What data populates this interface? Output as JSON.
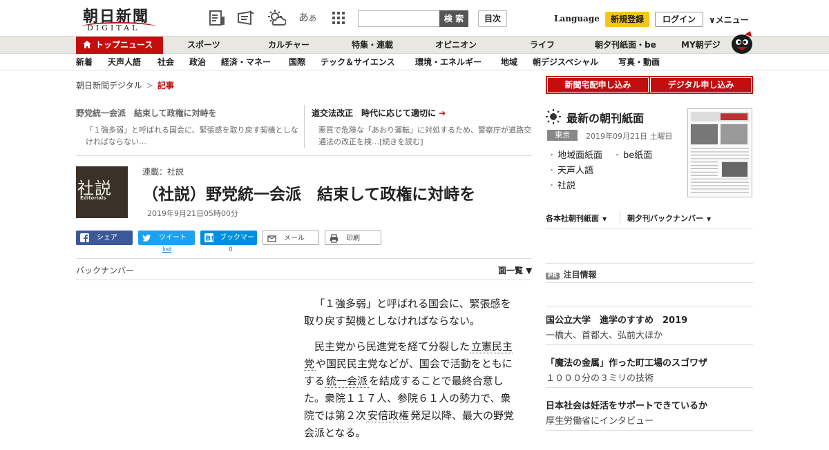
{
  "header": {
    "logo_jp": "朝日新聞",
    "logo_en": "DIGITAL",
    "icons": [
      "paper-view-icon",
      "newsletter-icon",
      "weather-icon"
    ],
    "font_size_label": "あ",
    "font_size_small": "あ",
    "search_placeholder": "",
    "search_button": "検 索",
    "contents_button": "目次",
    "language": "Language",
    "register": "新規登録",
    "login": "ログイン",
    "menu": "∨メニュー"
  },
  "nav_primary": [
    "トップニュース",
    "スポーツ",
    "カルチャー",
    "特集・連載",
    "オピニオン",
    "ライフ",
    "朝夕刊紙面・be",
    "MY朝デジ"
  ],
  "nav_secondary": [
    "新着",
    "天声人語",
    "社会",
    "政治",
    "経済・マネー",
    "国際",
    "テック＆サイエンス",
    "環境・エネルギー",
    "地域",
    "朝デジスペシャル",
    "写真・動画"
  ],
  "breadcrumb": {
    "root": "朝日新聞デジタル",
    "sep": ">",
    "current": "記事"
  },
  "related": [
    {
      "title": "野党統一会派　結束して政権に対峙を",
      "desc": "「１強多弱」と呼ばれる国会に、緊張感を取り戻す契機としなければならない…"
    },
    {
      "title": "道交法改正　時代に応じて適切に",
      "arrow": "➔",
      "desc": "悪質で危険な「あおり運転」に対処するため、警察庁が道路交通法の改正を検…[続きを読む]"
    }
  ],
  "article": {
    "image_kanji": "社説",
    "image_en": "Editorials",
    "series": "連載：社説",
    "headline": "（社説）野党統一会派　結束して政権に対峙を",
    "date": "2019年9月21日05時00分",
    "paragraph1": "「１強多弱」と呼ばれる国会に、緊張感を取り戻す契機としなければならない。",
    "p2_a": "民主党から民進党を経て分裂した",
    "p2_kw1": "立憲民主党",
    "p2_b": "や国民民主党などが、国会で活動をともにする",
    "p2_kw2": "統一会派",
    "p2_c": "を結成することで最終合意した。衆院１１７人、参院６１人の勢力で、衆院では第２次",
    "p2_kw3": "安倍政権",
    "p2_d": "発足以降、最大の野党会派となる。"
  },
  "share": {
    "facebook": "シェア",
    "twitter": "ツイート",
    "hatena": "ブックマーク",
    "mail": "メール",
    "print": "印刷",
    "twitter_count": "list",
    "hatena_count": "0"
  },
  "toolbar": {
    "backnumber": "バックナンバー",
    "list": "面一覧 ▼"
  },
  "sidebar": {
    "subscribe_paper": "新聞宅配申し込み",
    "subscribe_digital": "デジタル申し込み",
    "latest_title": "最新の朝刊紙面",
    "region": "東京",
    "latest_date": "2019年09月21日 土曜日",
    "links": [
      "地域面紙面",
      "be紙面",
      "天声人語",
      "社説"
    ],
    "tab1": "各本社朝刊紙面",
    "tab2": "朝夕刊バックナンバー",
    "pr_tag": "PR",
    "pr_title": "注目情報",
    "ads": [
      {
        "title": "国公立大学　進学のすすめ　2019",
        "sub": "一橋大、首都大、弘前大ほか"
      },
      {
        "title": "「魔法の金属」作った町工場のスゴワザ",
        "sub": "１０００分の３ミリの技術"
      },
      {
        "title": "日本社会は妊活をサポートできているか",
        "sub": "厚生労働省にインタビュー"
      }
    ]
  },
  "colors": {
    "brand_red": "#c40d0d",
    "register_yellow": "#f5c51b",
    "facebook": "#3b5998",
    "twitter": "#1da1f2",
    "hatena": "#008fde"
  }
}
